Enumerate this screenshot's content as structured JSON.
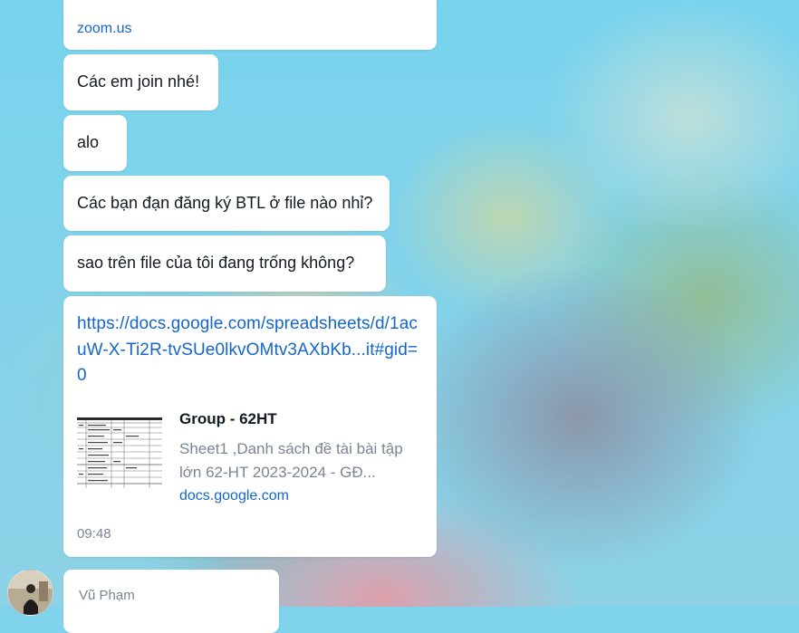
{
  "messages": [
    {
      "text": "zoom.us"
    },
    {
      "text": "Các em join nhé!"
    },
    {
      "text": "alo"
    },
    {
      "text": "Các bạn đạn đăng ký BTL ở file nào nhỉ?"
    },
    {
      "text": "sao trên file của tôi đang trống không?"
    }
  ],
  "link_message": {
    "url": "https://docs.google.com/spreadsheets/d/1acuW-X-Ti2R-tvSUe0lkvOMtv3AXbKb...it#gid=0",
    "preview": {
      "title": "Group - 62HT",
      "description": "Sheet1 ,Danh sách đề tài bài tập lớn 62-HT 2023-2024 - GĐ...",
      "domain": "docs.google.com"
    },
    "time": "09:48"
  },
  "next_message": {
    "sender": "Vũ Phạm"
  },
  "colors": {
    "link": "#1566c9",
    "bubble": "#ffffff",
    "muted_text": "#7a8493"
  }
}
